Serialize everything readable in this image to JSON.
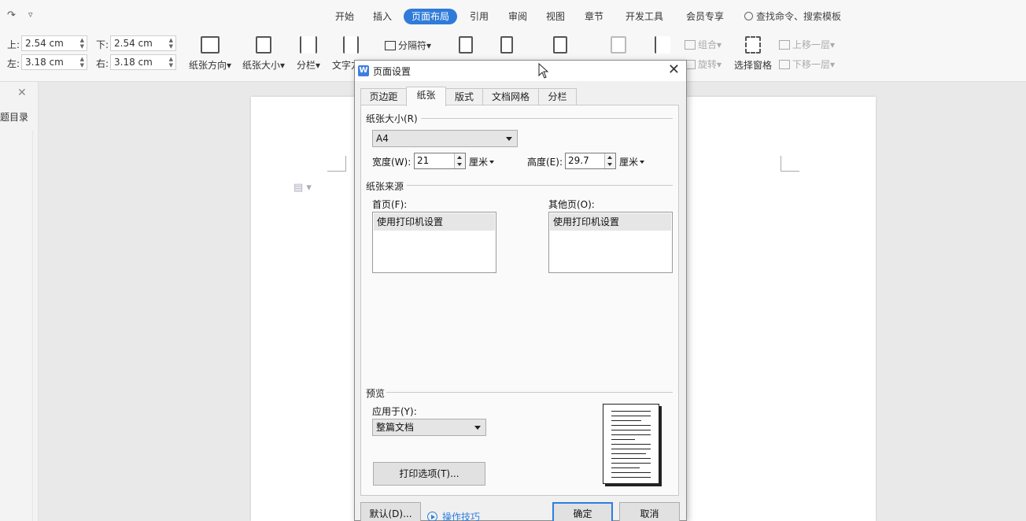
{
  "ribbon": {
    "quick_access": {
      "redo_icon": "↷",
      "customize_icon": "▿"
    },
    "menu_tabs": [
      {
        "label": "开始"
      },
      {
        "label": "插入"
      },
      {
        "label": "页面布局",
        "active": true
      },
      {
        "label": "引用"
      },
      {
        "label": "审阅"
      },
      {
        "label": "视图"
      },
      {
        "label": "章节"
      },
      {
        "label": "开发工具"
      },
      {
        "label": "会员专享"
      }
    ],
    "search_text": "查找命令、搜索模板",
    "margins": {
      "top_label": "上:",
      "top_value": "2.54 cm",
      "bottom_label": "下:",
      "bottom_value": "2.54 cm",
      "left_label": "左:",
      "left_value": "3.18 cm",
      "right_label": "右:",
      "right_value": "3.18 cm"
    },
    "buttons": {
      "orientation": "纸张方向",
      "size": "纸张大小",
      "columns": "分栏",
      "text_direction": "文字方向",
      "separator": "分隔符",
      "group": "组合",
      "rotate": "旋转",
      "selection_pane": "选择窗格",
      "bring_forward": "上移一层",
      "send_backward": "下移一层"
    }
  },
  "sidebar": {
    "label": "题目录"
  },
  "dialog": {
    "title": "页面设置",
    "tabs": [
      {
        "label": "页边距"
      },
      {
        "label": "纸张",
        "active": true
      },
      {
        "label": "版式"
      },
      {
        "label": "文档网格"
      },
      {
        "label": "分栏"
      }
    ],
    "paper_size": {
      "heading": "纸张大小(R)",
      "selected": "A4",
      "width_label": "宽度(W):",
      "width_value": "21",
      "width_unit": "厘米",
      "height_label": "高度(E):",
      "height_value": "29.7",
      "height_unit": "厘米"
    },
    "paper_source": {
      "heading": "纸张来源",
      "first_page_label": "首页(F):",
      "first_page_option": "使用打印机设置",
      "other_pages_label": "其他页(O):",
      "other_pages_option": "使用打印机设置"
    },
    "preview": {
      "heading": "预览",
      "apply_to_label": "应用于(Y):",
      "apply_to_value": "整篇文档",
      "print_options_button": "打印选项(T)..."
    },
    "footer": {
      "default_button": "默认(D)...",
      "tips_link": "操作技巧",
      "ok_button": "确定",
      "cancel_button": "取消"
    },
    "accent_color": "#2d7ee0"
  }
}
